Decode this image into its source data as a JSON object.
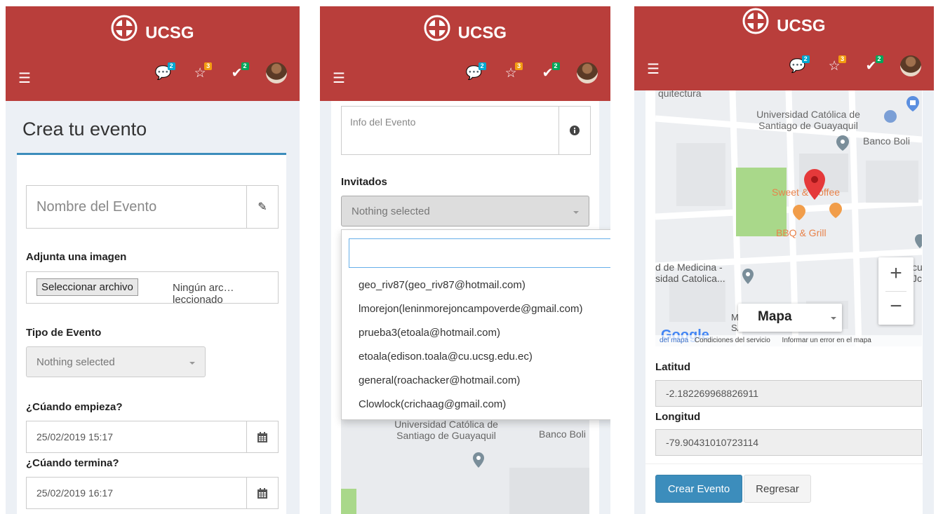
{
  "brand": {
    "name": "UCSG"
  },
  "header": {
    "menu_icon": "hamburger-icon",
    "badges": {
      "messages": "2",
      "favorites": "3",
      "tasks": "2"
    },
    "colors": {
      "header_bg": "#b93e3b",
      "messages_badge": "#00a7d0",
      "favorites_badge": "#f39c12",
      "tasks_badge": "#00a65a"
    }
  },
  "panel1": {
    "title": "Crea tu evento",
    "nombre_placeholder": "Nombre del Evento",
    "imagen_label": "Adjunta una imagen",
    "file_button": "Seleccionar archivo",
    "file_status": "Ningún arc…leccionado",
    "tipo_label": "Tipo de Evento",
    "tipo_value": "Nothing selected",
    "empieza_label": "¿Cúando empieza?",
    "empieza_value": "25/02/2019 15:17",
    "termina_label": "¿Cúando termina?",
    "termina_value": "25/02/2019 16:17"
  },
  "panel2": {
    "info_placeholder": "Info del Evento",
    "invitados_label": "Invitados",
    "invitados_value": "Nothing selected",
    "options": [
      "geo_riv87(geo_riv87@hotmail.com)",
      "lmorejon(leninmorejoncampoverde@gmail.com)",
      "prueba3(etoala@hotmail.com)",
      "etoala(edison.toala@cu.ucsg.edu.ec)",
      "general(roachacker@hotmail.com)",
      "Clowlock(crichaag@gmail.com)"
    ],
    "map_text": {
      "university": "Universidad Católica de",
      "university2": "Santiago de Guayaquil",
      "bank": "Banco Boli"
    }
  },
  "panel3": {
    "map": {
      "top_label": "quitectura",
      "university": "Universidad Católica de",
      "university2": "Santiago de Guayaquil",
      "bank": "Banco Boli",
      "cafe": "Sweet & Coffee",
      "grill": "BBQ & Grill",
      "medicina1": "d de Medicina -",
      "medicina2": "sidad Catolica...",
      "right_cut1": "cu",
      "right_cut2": "Jc",
      "min1": "MIN",
      "min2": "SAN",
      "maptype": "Mapa",
      "google": "Google",
      "footer1": "del mapa",
      "footer2": "Condiciones del servicio",
      "footer3": "Informar un error en el mapa"
    },
    "latitud_label": "Latitud",
    "latitud_value": "-2.182269968826911",
    "longitud_label": "Longitud",
    "longitud_value": "-79.90431010723114",
    "create_button": "Crear Evento",
    "back_button": "Regresar"
  }
}
